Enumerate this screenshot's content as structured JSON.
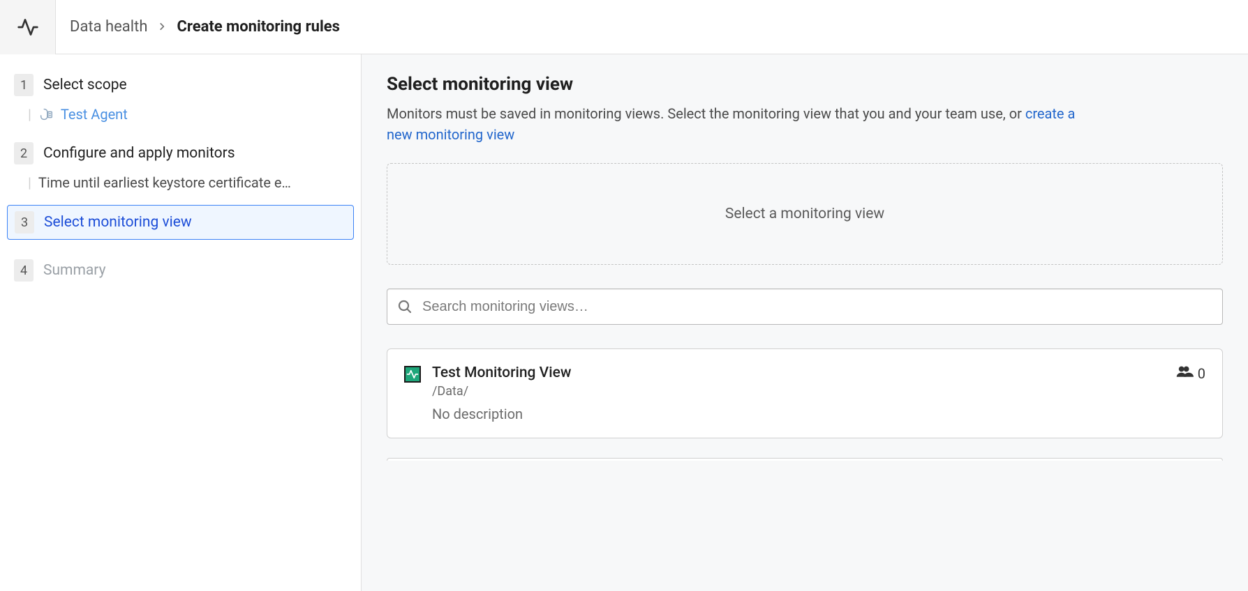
{
  "breadcrumb": {
    "parent": "Data health",
    "current": "Create monitoring rules"
  },
  "steps": [
    {
      "num": "1",
      "title": "Select scope",
      "sub": {
        "kind": "link",
        "text": "Test Agent"
      }
    },
    {
      "num": "2",
      "title": "Configure and apply monitors",
      "sub": {
        "kind": "text",
        "text": "Time until earliest keystore certificate e…"
      }
    },
    {
      "num": "3",
      "title": "Select monitoring view",
      "active": true
    },
    {
      "num": "4",
      "title": "Summary",
      "disabled": true
    }
  ],
  "main": {
    "heading": "Select monitoring view",
    "subtext_before": "Monitors must be saved in monitoring views. Select the monitoring view that you and your team use, or ",
    "subtext_link": "create a new monitoring view",
    "dropzone_text": "Select a monitoring view",
    "search_placeholder": "Search monitoring views…"
  },
  "results": [
    {
      "title": "Test Monitoring View",
      "path": "/Data/",
      "description": "No description",
      "user_count": "0"
    }
  ]
}
